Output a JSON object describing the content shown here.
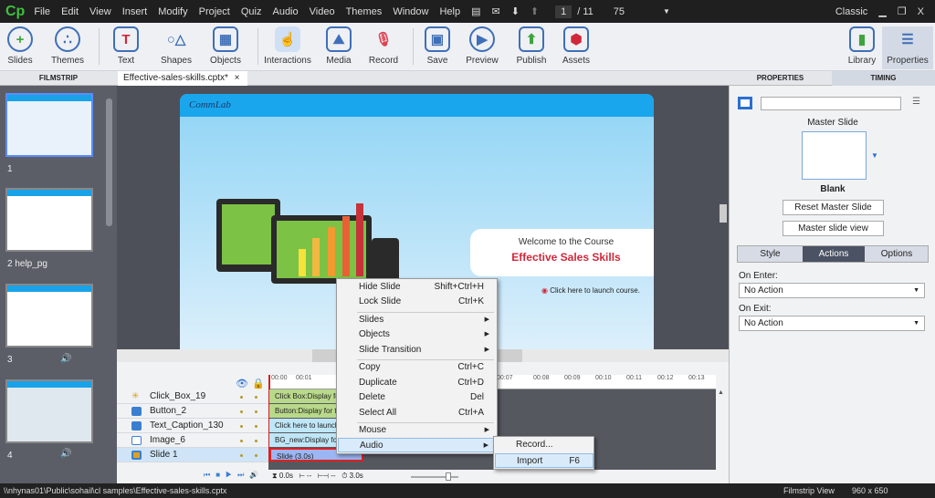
{
  "app": {
    "logo": "Cp",
    "menu": [
      "File",
      "Edit",
      "View",
      "Insert",
      "Modify",
      "Project",
      "Quiz",
      "Audio",
      "Video",
      "Themes",
      "Window",
      "Help"
    ],
    "current_slide": "1",
    "total_slides": "/ 11",
    "zoom": "75",
    "workspace": "Classic"
  },
  "toolbar": [
    "Slides",
    "Themes",
    "Text",
    "Shapes",
    "Objects",
    "Interactions",
    "Media",
    "Record",
    "Save",
    "Preview",
    "Publish",
    "Assets",
    "Library",
    "Properties"
  ],
  "tabs": {
    "filmstrip": "FILMSTRIP",
    "document": "Effective-sales-skills.cptx*",
    "close": "×",
    "properties": "PROPERTIES",
    "timing": "TIMING"
  },
  "filmstrip": [
    {
      "label": "1"
    },
    {
      "label": "2 help_pg"
    },
    {
      "label": "3"
    },
    {
      "label": "4"
    }
  ],
  "slide": {
    "logo": "CommLab",
    "welcome": "Welcome to the Course",
    "title": "Effective Sales Skills",
    "launch": "Click here to launch course.",
    "accent": "#d0283a"
  },
  "timeline": {
    "ruler": [
      "00:00",
      "00:01",
      "00:07",
      "00:08",
      "00:09",
      "00:10",
      "00:11",
      "00:12",
      "00:13"
    ],
    "rows": [
      {
        "name": "Click_Box_19",
        "bar": "Click Box:Display for the rest",
        "color": "#b9d98a"
      },
      {
        "name": "Button_2",
        "bar": "Button:Display for the rest",
        "color": "#b9d98a"
      },
      {
        "name": "Text_Caption_130",
        "bar": "Click here to launch course",
        "color": "#bfe6f7"
      },
      {
        "name": "Image_6",
        "bar": "BG_new:Display for the rest",
        "color": "#bfe6f7"
      },
      {
        "name": "Slide 1",
        "bar": "Slide (3.0s)",
        "color": "#9bb6f2"
      }
    ],
    "start": "0.0s",
    "in": "--",
    "out": "--",
    "duration": "3.0s"
  },
  "context_menu": {
    "items": [
      {
        "label": "Hide Slide",
        "shortcut": "Shift+Ctrl+H"
      },
      {
        "label": "Lock Slide",
        "shortcut": "Ctrl+K"
      },
      {
        "label": "Slides",
        "submenu": true
      },
      {
        "label": "Objects",
        "submenu": true
      },
      {
        "label": "Slide Transition",
        "submenu": true
      },
      {
        "label": "Copy",
        "shortcut": "Ctrl+C"
      },
      {
        "label": "Duplicate",
        "shortcut": "Ctrl+D"
      },
      {
        "label": "Delete",
        "shortcut": "Del"
      },
      {
        "label": "Select All",
        "shortcut": "Ctrl+A"
      },
      {
        "label": "Mouse",
        "submenu": true
      },
      {
        "label": "Audio",
        "submenu": true,
        "highlighted": true
      }
    ],
    "audio_submenu": [
      {
        "label": "Record...",
        "shortcut": ""
      },
      {
        "label": "Import",
        "shortcut": "F6",
        "highlighted": true
      }
    ]
  },
  "properties": {
    "master_slide_label": "Master Slide",
    "master_name": "Blank",
    "reset": "Reset Master Slide",
    "view": "Master slide view",
    "subtabs": [
      "Style",
      "Actions",
      "Options"
    ],
    "active_subtab": "Actions",
    "on_enter_label": "On Enter:",
    "on_enter": "No Action",
    "on_exit_label": "On Exit:",
    "on_exit": "No Action"
  },
  "status": {
    "path": "\\\\nhynas01\\Public\\sohail\\cl samples\\Effective-sales-skills.cptx",
    "view": "Filmstrip View",
    "size": "960 x 650"
  }
}
